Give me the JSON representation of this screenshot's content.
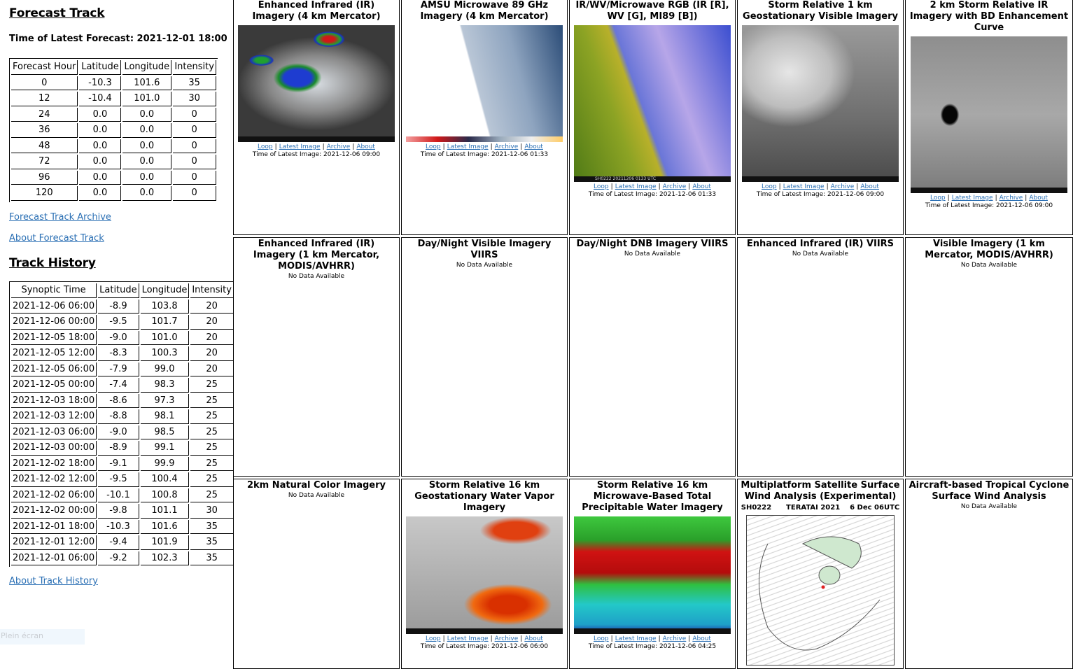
{
  "forecast": {
    "title": "Forecast Track",
    "latest_label": "Time of Latest Forecast: 2021-12-01 18:00",
    "columns": [
      "Forecast Hour",
      "Latitude",
      "Longitude",
      "Intensity"
    ],
    "rows": [
      [
        "0",
        "-10.3",
        "101.6",
        "35"
      ],
      [
        "12",
        "-10.4",
        "101.0",
        "30"
      ],
      [
        "24",
        "0.0",
        "0.0",
        "0"
      ],
      [
        "36",
        "0.0",
        "0.0",
        "0"
      ],
      [
        "48",
        "0.0",
        "0.0",
        "0"
      ],
      [
        "72",
        "0.0",
        "0.0",
        "0"
      ],
      [
        "96",
        "0.0",
        "0.0",
        "0"
      ],
      [
        "120",
        "0.0",
        "0.0",
        "0"
      ]
    ],
    "archive_link": "Forecast Track Archive",
    "about_link": "About Forecast Track"
  },
  "history": {
    "title": "Track History",
    "columns": [
      "Synoptic Time",
      "Latitude",
      "Longitude",
      "Intensity"
    ],
    "rows": [
      [
        "2021-12-06 06:00",
        "-8.9",
        "103.8",
        "20"
      ],
      [
        "2021-12-06 00:00",
        "-9.5",
        "101.7",
        "20"
      ],
      [
        "2021-12-05 18:00",
        "-9.0",
        "101.0",
        "20"
      ],
      [
        "2021-12-05 12:00",
        "-8.3",
        "100.3",
        "20"
      ],
      [
        "2021-12-05 06:00",
        "-7.9",
        "99.0",
        "20"
      ],
      [
        "2021-12-05 00:00",
        "-7.4",
        "98.3",
        "25"
      ],
      [
        "2021-12-03 18:00",
        "-8.6",
        "97.3",
        "25"
      ],
      [
        "2021-12-03 12:00",
        "-8.8",
        "98.1",
        "25"
      ],
      [
        "2021-12-03 06:00",
        "-9.0",
        "98.5",
        "25"
      ],
      [
        "2021-12-03 00:00",
        "-8.9",
        "99.1",
        "25"
      ],
      [
        "2021-12-02 18:00",
        "-9.1",
        "99.9",
        "25"
      ],
      [
        "2021-12-02 12:00",
        "-9.5",
        "100.4",
        "25"
      ],
      [
        "2021-12-02 06:00",
        "-10.1",
        "100.8",
        "25"
      ],
      [
        "2021-12-02 00:00",
        "-9.8",
        "101.1",
        "30"
      ],
      [
        "2021-12-01 18:00",
        "-10.3",
        "101.6",
        "35"
      ],
      [
        "2021-12-01 12:00",
        "-9.4",
        "101.9",
        "35"
      ],
      [
        "2021-12-01 06:00",
        "-9.2",
        "102.3",
        "35"
      ]
    ],
    "about_link": "About Track History"
  },
  "fullscreen_label": "Plein écran",
  "link_labels": {
    "loop": "Loop",
    "latest": "Latest Image",
    "archive": "Archive",
    "about": "About",
    "separator": "|"
  },
  "panels": [
    {
      "title": "Enhanced Infrared (IR) Imagery (4 km Mercator)",
      "image": "ir-4km",
      "time": "Time of Latest Image: 2021-12-06 09:00"
    },
    {
      "title": "AMSU Microwave 89 GHz Imagery (4 km Mercator)",
      "image": "amsu-89",
      "time": "Time of Latest Image: 2021-12-06 01:33"
    },
    {
      "title": "IR/WV/Microwave RGB (IR [R], WV [G], MI89 [B])",
      "image": "rgb",
      "time": "Time of Latest Image: 2021-12-06 01:33",
      "image_caption": "SH0222 20211206 0133 UTC"
    },
    {
      "title": "Storm Relative 1 km Geostationary Visible Imagery",
      "image": "vis-1km",
      "time": "Time of Latest Image: 2021-12-06 09:00"
    },
    {
      "title": "2 km Storm Relative IR Imagery with BD Enhancement Curve",
      "image": "ir-bd",
      "time": "Time of Latest Image: 2021-12-06 09:00"
    },
    {
      "title": "Enhanced Infrared (IR) Imagery (1 km Mercator, MODIS/AVHRR)",
      "nodata": "No Data Available"
    },
    {
      "title": "Day/Night Visible Imagery VIIRS",
      "nodata": "No Data Available"
    },
    {
      "title": "Day/Night DNB Imagery VIIRS",
      "nodata": "No Data Available"
    },
    {
      "title": "Enhanced Infrared (IR) VIIRS",
      "nodata": "No Data Available"
    },
    {
      "title": "Visible Imagery (1 km Mercator, MODIS/AVHRR)",
      "nodata": "No Data Available"
    },
    {
      "title": "2km Natural Color Imagery",
      "nodata": "No Data Available"
    },
    {
      "title": "Storm Relative 16 km Geostationary Water Vapor Imagery",
      "image": "wv-16km",
      "time": "Time of Latest Image: 2021-12-06 06:00"
    },
    {
      "title": "Storm Relative 16 km Microwave-Based Total Precipitable Water Imagery",
      "image": "tpw",
      "time": "Time of Latest Image: 2021-12-06 04:25"
    },
    {
      "title": "Multiplatform Satellite Surface Wind Analysis (Experimental)",
      "image": "wind-analysis",
      "image_caption": "SH0222      TERATAI 2021    6 Dec 06UTC"
    },
    {
      "title": "Aircraft-based Tropical Cyclone Surface Wind Analysis",
      "nodata": "No Data Available"
    }
  ]
}
